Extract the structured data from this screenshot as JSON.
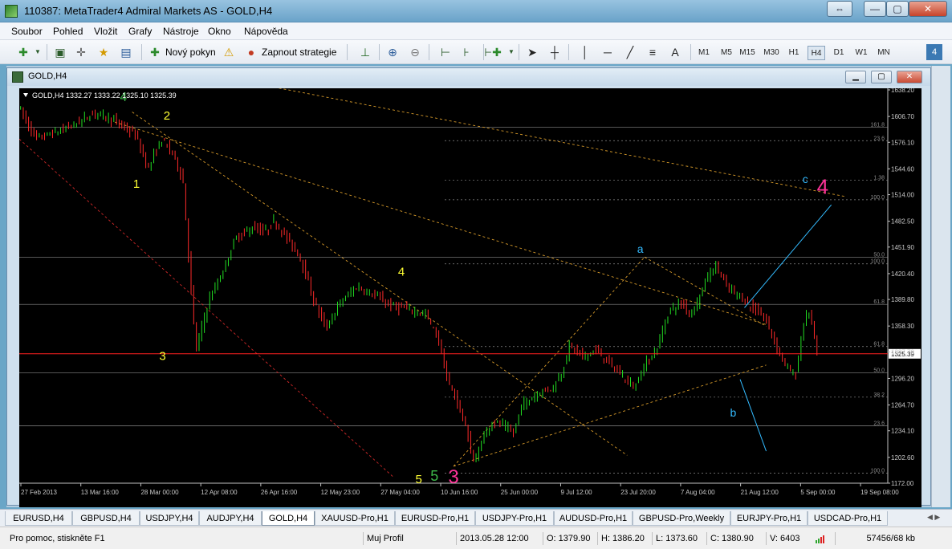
{
  "window": {
    "title": "110387: MetaTrader4 Admiral Markets AS - GOLD,H4",
    "buttons": {
      "swap": "⇔",
      "minimize": "—",
      "maximize": "▢",
      "close": "✕"
    }
  },
  "menu": [
    "Soubor",
    "Pohled",
    "Vložit",
    "Grafy",
    "Nástroje",
    "Okno",
    "Nápověda"
  ],
  "toolbar": {
    "new_order": "Nový pokyn",
    "autotrading": "Zapnout strategie",
    "tool_labels": {
      "text": "A"
    },
    "timeframes": [
      "M1",
      "M5",
      "M15",
      "M30",
      "H1",
      "H4",
      "D1",
      "W1",
      "MN"
    ],
    "active_timeframe": "H4",
    "badge": "4"
  },
  "chart_window": {
    "title": "GOLD,H4",
    "buttons": {
      "minimize": "▁",
      "maximize": "▢",
      "close": "✕"
    }
  },
  "chart_data": {
    "type": "candlestick",
    "symbol": "GOLD",
    "timeframe": "H4",
    "header": "GOLD,H4 1332.27 1333.22 1325.10 1325.39",
    "current_price": 1325.39,
    "y_range": [
      1172.0,
      1638.2
    ],
    "y_ticks": [
      "1638.20",
      "1606.70",
      "1576.10",
      "1544.60",
      "1514.00",
      "1482.50",
      "1451.90",
      "1420.40",
      "1389.80",
      "1358.30",
      "1327.70",
      "1296.20",
      "1264.70",
      "1234.10",
      "1202.60",
      "1172.00"
    ],
    "x_ticks": [
      "27 Feb 2013",
      "13 Mar 16:00",
      "28 Mar 00:00",
      "12 Apr 08:00",
      "26 Apr 16:00",
      "12 May 23:00",
      "27 May 04:00",
      "10 Jun 16:00",
      "25 Jun 00:00",
      "9 Jul 12:00",
      "23 Jul 20:00",
      "7 Aug 04:00",
      "21 Aug 12:00",
      "5 Sep 00:00",
      "19 Sep 08:00"
    ],
    "price_path": [
      [
        0,
        1620
      ],
      [
        0.02,
        1580
      ],
      [
        0.05,
        1590
      ],
      [
        0.07,
        1600
      ],
      [
        0.09,
        1612
      ],
      [
        0.11,
        1602
      ],
      [
        0.135,
        1585
      ],
      [
        0.15,
        1545
      ],
      [
        0.165,
        1580
      ],
      [
        0.18,
        1560
      ],
      [
        0.19,
        1530
      ],
      [
        0.195,
        1460
      ],
      [
        0.2,
        1390
      ],
      [
        0.205,
        1330
      ],
      [
        0.21,
        1350
      ],
      [
        0.22,
        1390
      ],
      [
        0.235,
        1420
      ],
      [
        0.25,
        1462
      ],
      [
        0.27,
        1475
      ],
      [
        0.285,
        1470
      ],
      [
        0.295,
        1483
      ],
      [
        0.31,
        1462
      ],
      [
        0.325,
        1440
      ],
      [
        0.34,
        1390
      ],
      [
        0.355,
        1355
      ],
      [
        0.37,
        1385
      ],
      [
        0.39,
        1405
      ],
      [
        0.41,
        1395
      ],
      [
        0.43,
        1382
      ],
      [
        0.45,
        1378
      ],
      [
        0.47,
        1372
      ],
      [
        0.485,
        1340
      ],
      [
        0.495,
        1290
      ],
      [
        0.505,
        1272
      ],
      [
        0.515,
        1240
      ],
      [
        0.525,
        1195
      ],
      [
        0.535,
        1225
      ],
      [
        0.545,
        1245
      ],
      [
        0.56,
        1240
      ],
      [
        0.57,
        1230
      ],
      [
        0.58,
        1265
      ],
      [
        0.59,
        1272
      ],
      [
        0.6,
        1280
      ],
      [
        0.615,
        1285
      ],
      [
        0.625,
        1300
      ],
      [
        0.635,
        1335
      ],
      [
        0.65,
        1322
      ],
      [
        0.665,
        1330
      ],
      [
        0.68,
        1315
      ],
      [
        0.695,
        1300
      ],
      [
        0.71,
        1285
      ],
      [
        0.72,
        1310
      ],
      [
        0.735,
        1330
      ],
      [
        0.75,
        1378
      ],
      [
        0.765,
        1385
      ],
      [
        0.775,
        1372
      ],
      [
        0.785,
        1395
      ],
      [
        0.795,
        1420
      ],
      [
        0.805,
        1430
      ],
      [
        0.815,
        1405
      ],
      [
        0.83,
        1395
      ],
      [
        0.845,
        1380
      ],
      [
        0.86,
        1368
      ],
      [
        0.875,
        1330
      ],
      [
        0.885,
        1310
      ],
      [
        0.895,
        1298
      ],
      [
        0.905,
        1365
      ],
      [
        0.912,
        1375
      ],
      [
        0.92,
        1325
      ]
    ],
    "levels": {
      "fib_right": [
        {
          "label": "161.8",
          "price": 1594
        },
        {
          "label": "23.6",
          "price": 1578
        },
        {
          "label": "1.38",
          "price": 1531
        },
        {
          "label": "100.0",
          "price": 1508
        },
        {
          "label": "50.0",
          "price": 1440
        },
        {
          "label": "100.0",
          "price": 1432
        },
        {
          "label": "61.8",
          "price": 1384
        },
        {
          "label": "61.8",
          "price": 1334
        },
        {
          "label": "50.0",
          "price": 1303
        },
        {
          "label": "38.2",
          "price": 1274
        },
        {
          "label": "23.6",
          "price": 1240
        },
        {
          "label": "100.0",
          "price": 1184
        }
      ],
      "price_line_color": "#ff2020"
    },
    "wave_labels": [
      {
        "text": "4",
        "price": 1625,
        "x": 0.12,
        "color": "#3db84a",
        "size": 16
      },
      {
        "text": "2",
        "price": 1603,
        "x": 0.17,
        "color": "#ffff33",
        "size": 15
      },
      {
        "text": "1",
        "price": 1522,
        "x": 0.135,
        "color": "#ffff33",
        "size": 15
      },
      {
        "text": "3",
        "price": 1318,
        "x": 0.165,
        "color": "#ffff33",
        "size": 15
      },
      {
        "text": "4",
        "price": 1418,
        "x": 0.44,
        "color": "#ffff33",
        "size": 15
      },
      {
        "text": "5",
        "price": 1172,
        "x": 0.46,
        "color": "#ffff33",
        "size": 15
      },
      {
        "text": "5",
        "price": 1175,
        "x": 0.478,
        "color": "#3db84a",
        "size": 18
      },
      {
        "text": "3",
        "price": 1172,
        "x": 0.5,
        "color": "#ff3399",
        "size": 24
      },
      {
        "text": "a",
        "price": 1445,
        "x": 0.715,
        "color": "#33bbff",
        "size": 14
      },
      {
        "text": "c",
        "price": 1528,
        "x": 0.905,
        "color": "#33bbff",
        "size": 14
      },
      {
        "text": "4",
        "price": 1515,
        "x": 0.925,
        "color": "#ff3399",
        "size": 26
      },
      {
        "text": "b",
        "price": 1251,
        "x": 0.822,
        "color": "#33bbff",
        "size": 14
      }
    ],
    "trend_lines": [
      {
        "from": [
          0.0,
          1580
        ],
        "to": [
          0.43,
          1180
        ],
        "color": "#d02828"
      },
      {
        "from": [
          0.13,
          1612
        ],
        "to": [
          0.7,
          1205
        ],
        "color": "#d69a2a"
      },
      {
        "from": [
          0.11,
          1600
        ],
        "to": [
          0.86,
          1360
        ],
        "color": "#d69a2a"
      },
      {
        "from": [
          0.25,
          1650
        ],
        "to": [
          0.95,
          1512
        ],
        "color": "#d69a2a"
      },
      {
        "from": [
          0.5,
          1192
        ],
        "to": [
          0.86,
          1312
        ],
        "color": "#d69a2a"
      },
      {
        "from": [
          0.72,
          1440
        ],
        "to": [
          0.86,
          1358
        ],
        "color": "#d69a2a"
      },
      {
        "from": [
          0.5,
          1192
        ],
        "to": [
          0.72,
          1440
        ],
        "color": "#d69a2a"
      }
    ],
    "projection_lines": [
      {
        "from": [
          0.835,
          1380
        ],
        "to": [
          0.935,
          1502
        ],
        "color": "#33bbff"
      },
      {
        "from": [
          0.83,
          1295
        ],
        "to": [
          0.86,
          1210
        ],
        "color": "#33bbff"
      }
    ]
  },
  "symbol_tabs": [
    "EURUSD,H4",
    "GBPUSD,H4",
    "USDJPY,H4",
    "AUDJPY,H4",
    "GOLD,H4",
    "XAUUSD-Pro,H1",
    "EURUSD-Pro,H1",
    "USDJPY-Pro,H1",
    "AUDUSD-Pro,H1",
    "GBPUSD-Pro,Weekly",
    "EURJPY-Pro,H1",
    "USDCAD-Pro,H1"
  ],
  "active_tab": "GOLD,H4",
  "status": {
    "help": "Pro pomoc, stiskněte F1",
    "profile": "Muj Profil",
    "datetime": "2013.05.28 12:00",
    "open": "O: 1379.90",
    "high": "H: 1386.20",
    "low": "L: 1373.60",
    "close": "C: 1380.90",
    "volume": "V: 6403",
    "traffic": "57456/68 kb"
  }
}
